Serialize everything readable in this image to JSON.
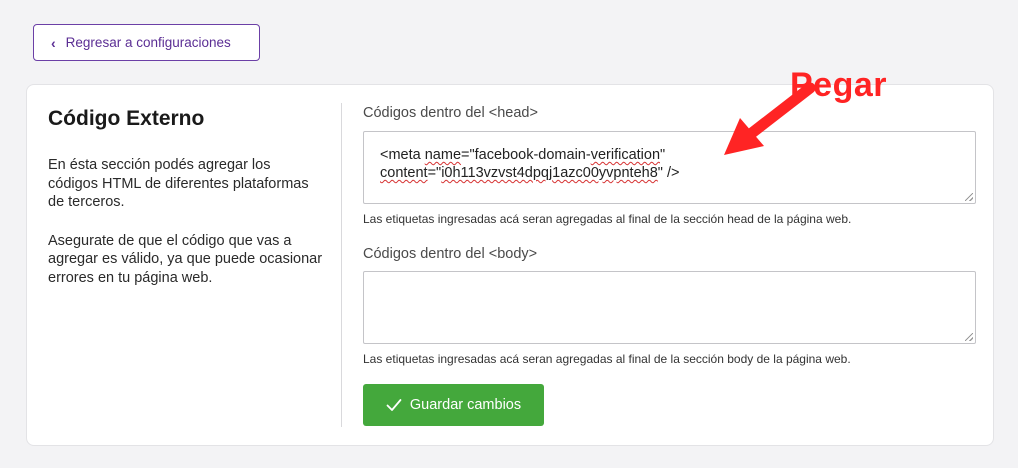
{
  "back_button": {
    "label": "Regresar a configuraciones",
    "icon": "chevron-left-icon"
  },
  "section": {
    "title": "Código Externo",
    "description_1": "En ésta sección podés agregar los códigos HTML de diferentes plataformas de terceros.",
    "description_2": "Asegurate de que el código que vas a agregar es válido, ya que puede ocasionar errores en tu página web."
  },
  "head_field": {
    "label": "Códigos dentro del <head>",
    "value_line1_prefix": "<meta ",
    "value_line1_spell": "name",
    "value_line1_mid": "=\"facebook-domain-",
    "value_line1_spell2": "verification",
    "value_line1_suffix": "\"",
    "value_line2_spell": "content",
    "value_line2_mid": "=\"",
    "value_line2_spell2": "i0h113vzvst4dpqj1azc00yvpnteh8",
    "value_line2_suffix": "\" />",
    "help": "Las etiquetas ingresadas acá seran agregadas al final de la sección head de la página web."
  },
  "body_field": {
    "label": "Códigos dentro del <body>",
    "value": "",
    "help": "Las etiquetas ingresadas acá seran agregadas al final de la sección body de la página web."
  },
  "save_button": {
    "label": "Guardar cambios",
    "icon": "check-icon"
  },
  "annotation": {
    "text": "Pegar",
    "color": "#ff2424"
  },
  "colors": {
    "accent_purple": "#6b3fa6",
    "save_green": "#44a83c"
  }
}
